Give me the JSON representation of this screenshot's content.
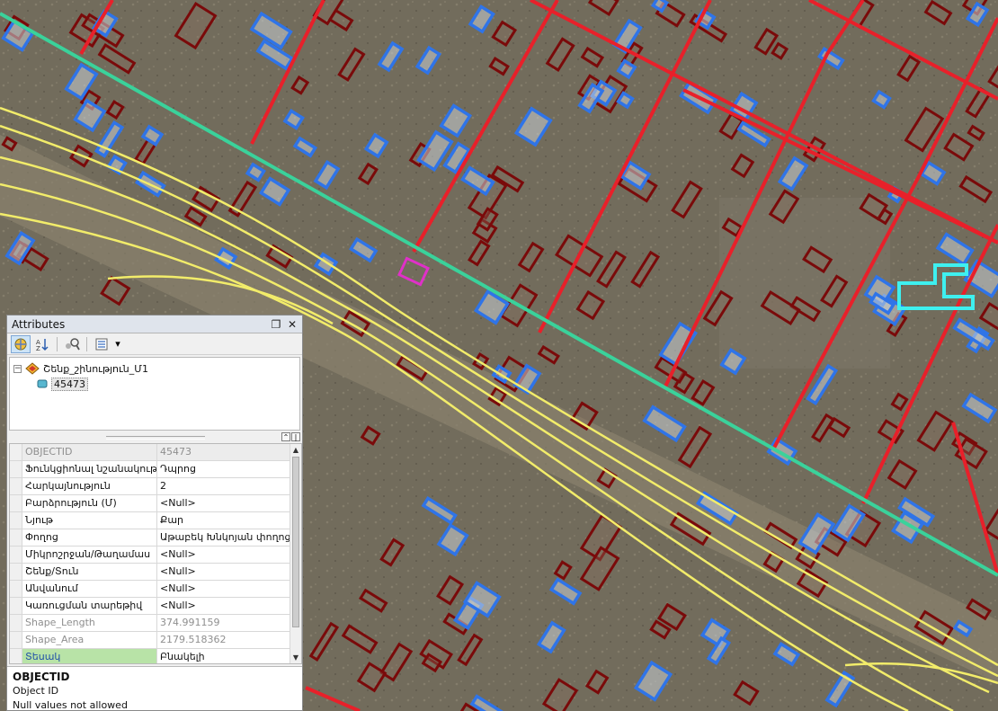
{
  "map": {
    "colors": {
      "building_outline": "#7a0a0a",
      "building_blue_outline": "#2f74e8",
      "road": "#e8202a",
      "road_teal": "#3ad29b",
      "rail": "#f2ec6a",
      "selection_magenta": "#e030c8",
      "selection_cyan": "#3ef0f0",
      "imagery_base": "#716b5b"
    }
  },
  "window": {
    "title": "Attributes",
    "buttons": {
      "restore_icon": "restore-window-icon",
      "close_icon": "close-icon"
    },
    "restore_glyph": "❐",
    "close_glyph": "✕"
  },
  "toolbar": {
    "icons": [
      "show-selected-icon",
      "sort-ascending-icon",
      "identify-icon",
      "options-icon"
    ],
    "dropdown_glyph": "▾"
  },
  "tree": {
    "layer_name": "Շենք_շինություն_Մ1",
    "feature_id": "45473",
    "expander_glyph": "−"
  },
  "grid": {
    "rows": [
      {
        "field": "OBJECTID",
        "value": "45473",
        "readonly": true
      },
      {
        "field": "Ֆունկցիոնալ նշանակություն",
        "value": "Դպրոց",
        "readonly": false
      },
      {
        "field": "Հարկայնություն",
        "value": "2",
        "readonly": false
      },
      {
        "field": "Բարձրություն (Մ)",
        "value": "<Null>",
        "readonly": false
      },
      {
        "field": "Նյութ",
        "value": "Քար",
        "readonly": false
      },
      {
        "field": "Փողոց",
        "value": "Աթաբեկ Խնկոյան փողոց",
        "readonly": false
      },
      {
        "field": "Միկրոշրջան/Թաղամաս",
        "value": "<Null>",
        "readonly": false
      },
      {
        "field": "Շենք/Տուն",
        "value": "<Null>",
        "readonly": false
      },
      {
        "field": "Անվանում",
        "value": "<Null>",
        "readonly": false
      },
      {
        "field": "Կառուցման տարեթիվ",
        "value": "<Null>",
        "readonly": false
      },
      {
        "field": "Shape_Length",
        "value": "374.991159",
        "readonly": true
      },
      {
        "field": "Shape_Area",
        "value": "2179.518362",
        "readonly": true
      },
      {
        "field": "Տեսակ",
        "value": "Բնակելի",
        "readonly": false
      }
    ]
  },
  "description": {
    "title": "OBJECTID",
    "line1": "Object ID",
    "line2": "Null values not allowed"
  }
}
